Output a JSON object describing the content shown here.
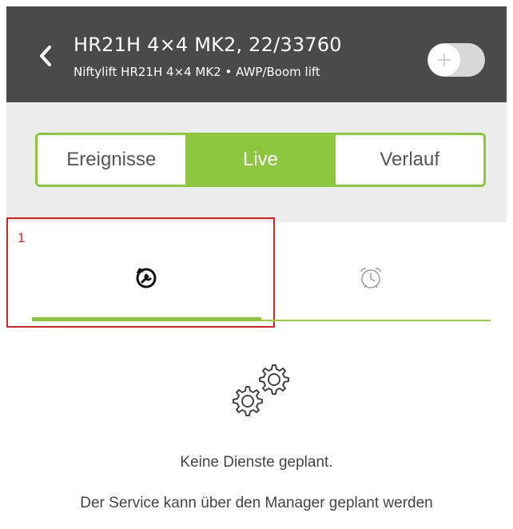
{
  "header": {
    "title": "HR21H 4×4 MK2, 22/33760",
    "subtitle": "Niftylift HR21H 4×4 MK2 • AWP/Boom lift",
    "back_icon": "chevron-left-icon",
    "toggle_icon": "plus-icon",
    "toggle_on": false
  },
  "segments": [
    {
      "label": "Ereignisse",
      "active": false
    },
    {
      "label": "Live",
      "active": true
    },
    {
      "label": "Verlauf",
      "active": false
    }
  ],
  "annotation": {
    "label": "1"
  },
  "tabs": [
    {
      "icon": "service-wrench-icon",
      "active": true
    },
    {
      "icon": "alarm-clock-icon",
      "active": false
    }
  ],
  "empty_state": {
    "icon": "gears-icon",
    "title": "Keine Dienste geplant.",
    "description": "Der Service kann über den Manager geplant werden"
  },
  "colors": {
    "header_bg": "#4a4a4a",
    "accent": "#8cc63f",
    "segment_bg": "#ececec",
    "annotation": "#e02020"
  }
}
